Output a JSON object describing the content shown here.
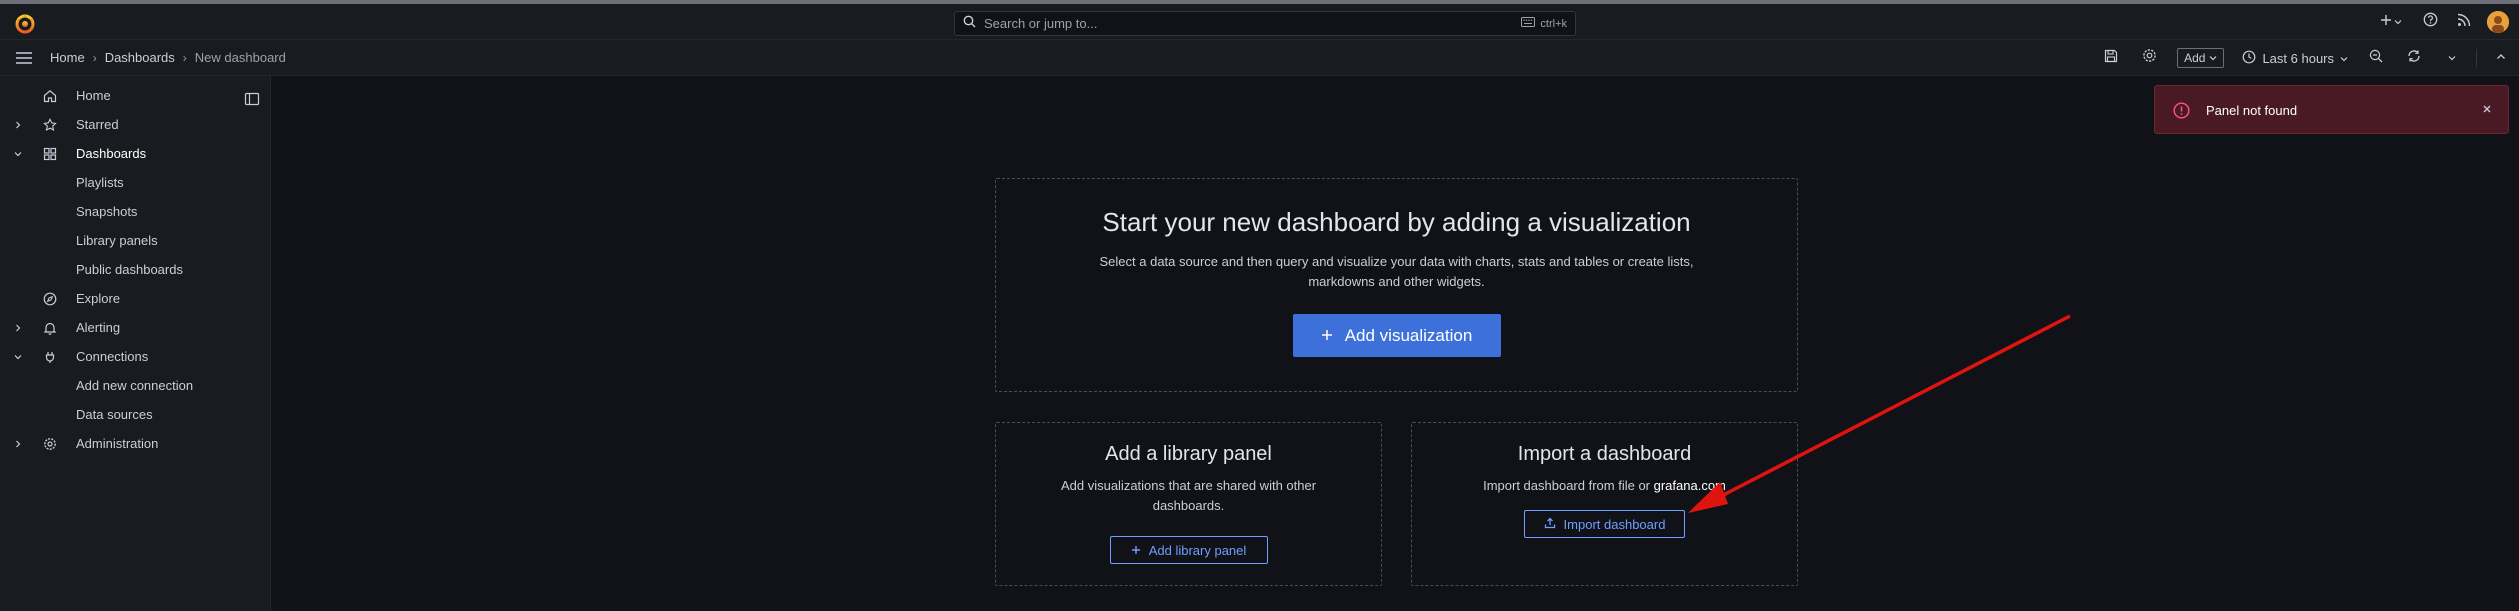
{
  "topbar": {
    "search_placeholder": "Search or jump to...",
    "search_shortcut": "ctrl+k"
  },
  "breadcrumb": {
    "home": "Home",
    "dashboards": "Dashboards",
    "current": "New dashboard"
  },
  "toolbar": {
    "add_label": "Add",
    "time_range": "Last 6 hours"
  },
  "sidebar": {
    "items": [
      {
        "label": "Home",
        "icon": "home-icon",
        "chevron": ""
      },
      {
        "label": "Starred",
        "icon": "star-icon",
        "chevron": "right"
      },
      {
        "label": "Dashboards",
        "icon": "apps-icon",
        "chevron": "down"
      },
      {
        "label": "Playlists",
        "icon": "",
        "chevron": ""
      },
      {
        "label": "Snapshots",
        "icon": "",
        "chevron": ""
      },
      {
        "label": "Library panels",
        "icon": "",
        "chevron": ""
      },
      {
        "label": "Public dashboards",
        "icon": "",
        "chevron": ""
      },
      {
        "label": "Explore",
        "icon": "compass-icon",
        "chevron": ""
      },
      {
        "label": "Alerting",
        "icon": "bell-icon",
        "chevron": "right"
      },
      {
        "label": "Connections",
        "icon": "plug-icon",
        "chevron": "down"
      },
      {
        "label": "Add new connection",
        "icon": "",
        "chevron": ""
      },
      {
        "label": "Data sources",
        "icon": "",
        "chevron": ""
      },
      {
        "label": "Administration",
        "icon": "cog-icon",
        "chevron": "right"
      }
    ]
  },
  "main": {
    "heading": "Start your new dashboard by adding a visualization",
    "description": "Select a data source and then query and visualize your data with charts, stats and tables or create lists, markdowns and other widgets.",
    "add_visualization": "Add visualization",
    "library": {
      "title": "Add a library panel",
      "description": "Add visualizations that are shared with other dashboards.",
      "button": "Add library panel"
    },
    "import": {
      "title": "Import a dashboard",
      "description_prefix": "Import dashboard from file or",
      "description_link": "grafana.com",
      "button": "Import dashboard"
    }
  },
  "toast": {
    "message": "Panel not found",
    "color": "#4a1a24"
  },
  "colors": {
    "accent": "#3d71d9",
    "link": "#6e9fff",
    "annotation_arrow": "#e0140f"
  }
}
